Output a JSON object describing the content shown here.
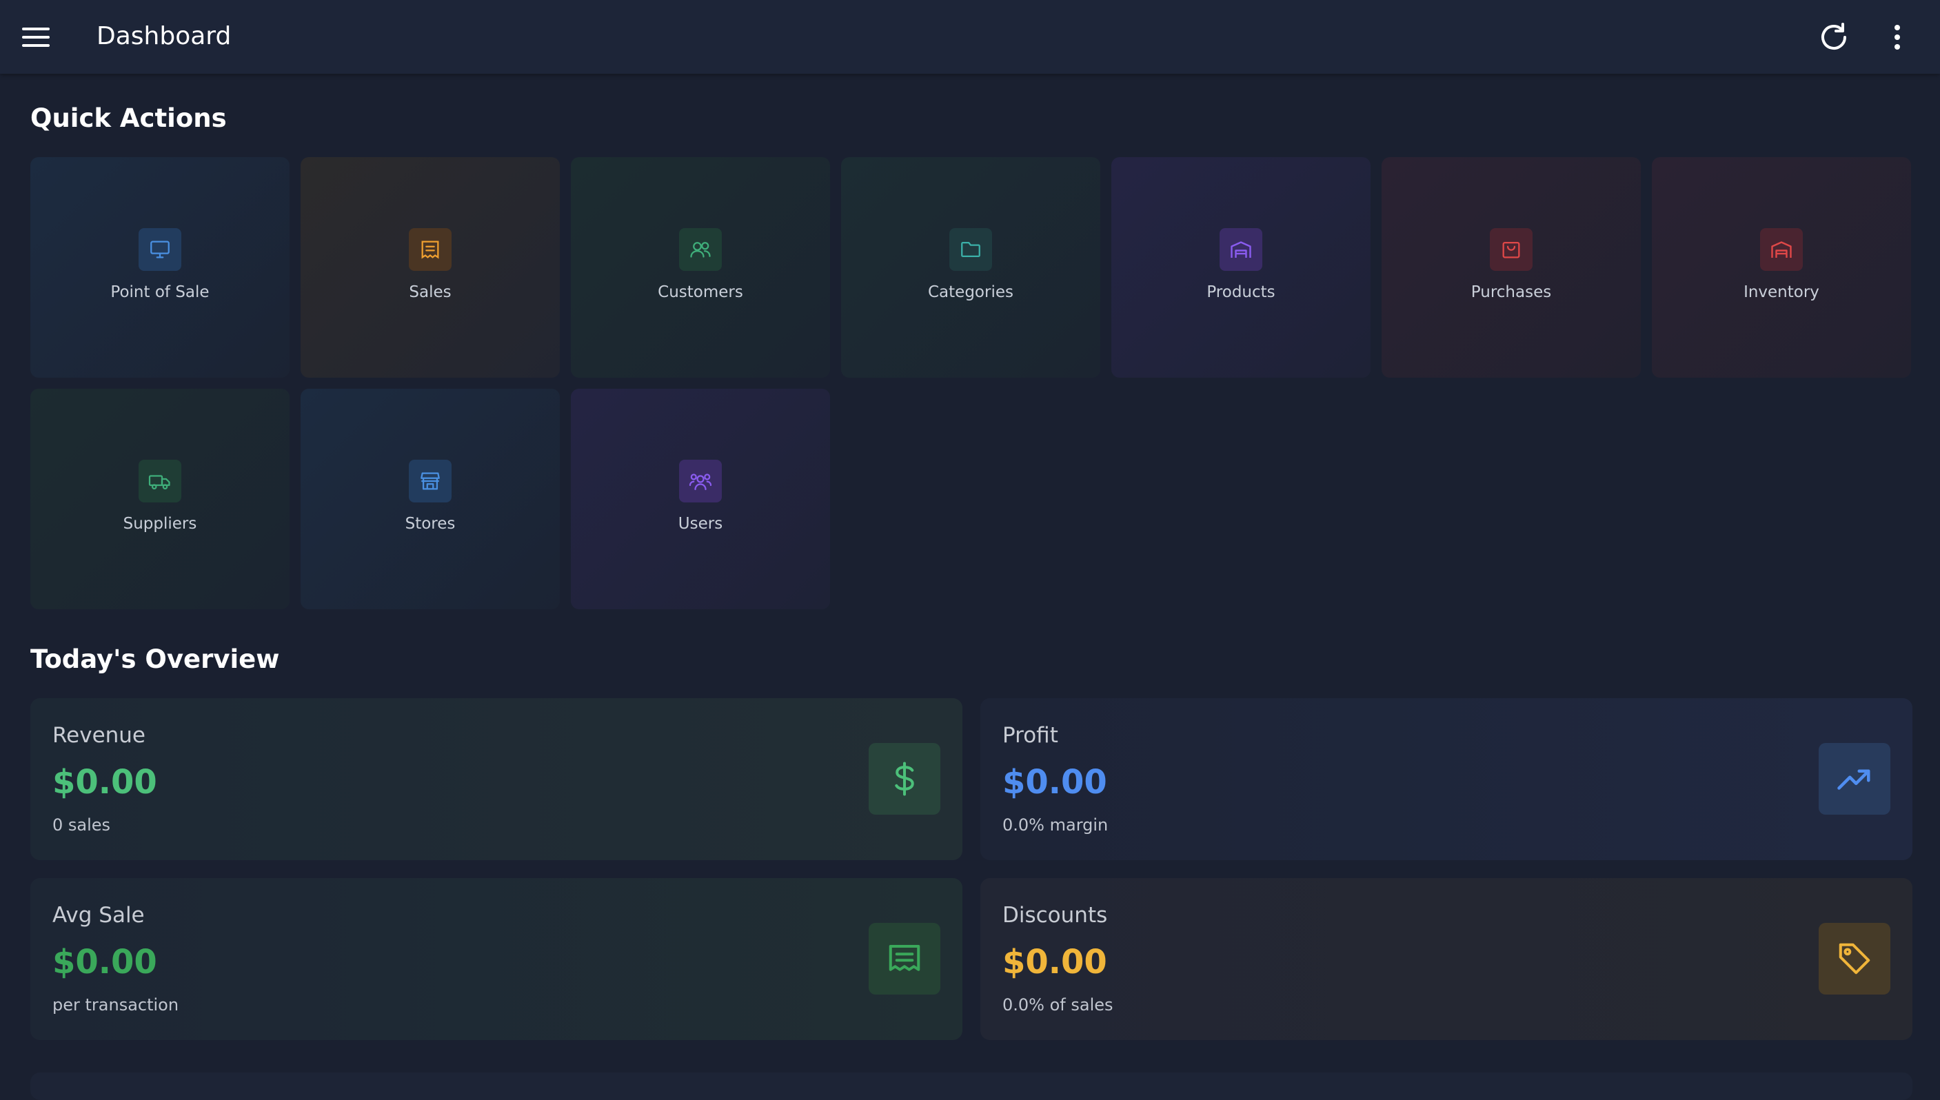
{
  "appbar": {
    "title": "Dashboard",
    "menu_icon": "hamburger-menu-icon",
    "refresh_icon": "refresh-icon",
    "more_icon": "more-vertical-icon"
  },
  "quick_actions": {
    "title": "Quick Actions",
    "tiles": [
      {
        "label": "Point of Sale",
        "icon": "monitor-icon",
        "color": "#4a90e2"
      },
      {
        "label": "Sales",
        "icon": "receipt-icon",
        "color": "#f0a030"
      },
      {
        "label": "Customers",
        "icon": "users-icon",
        "color": "#3fae7a"
      },
      {
        "label": "Categories",
        "icon": "folder-icon",
        "color": "#3bb0a8"
      },
      {
        "label": "Products",
        "icon": "warehouse-icon",
        "color": "#8a5cf0"
      },
      {
        "label": "Purchases",
        "icon": "shopping-bag-icon",
        "color": "#e04848"
      },
      {
        "label": "Inventory",
        "icon": "warehouse-icon",
        "color": "#e04848"
      },
      {
        "label": "Suppliers",
        "icon": "truck-icon",
        "color": "#3fae7a"
      },
      {
        "label": "Stores",
        "icon": "store-icon",
        "color": "#4a90e2"
      },
      {
        "label": "Users",
        "icon": "user-group-icon",
        "color": "#8a5cf0"
      }
    ]
  },
  "overview": {
    "title": "Today's Overview",
    "cards": [
      {
        "label": "Revenue",
        "value": "$0.00",
        "sub": "0 sales",
        "icon": "dollar-icon",
        "color": "#4cc07a"
      },
      {
        "label": "Profit",
        "value": "$0.00",
        "sub": "0.0% margin",
        "icon": "trending-up-icon",
        "color": "#4f8df0"
      },
      {
        "label": "Avg Sale",
        "value": "$0.00",
        "sub": "per transaction",
        "icon": "receipt-icon",
        "color": "#3aa85a"
      },
      {
        "label": "Discounts",
        "value": "$0.00",
        "sub": "0.0% of sales",
        "icon": "tag-icon",
        "color": "#f0b53a"
      }
    ]
  }
}
